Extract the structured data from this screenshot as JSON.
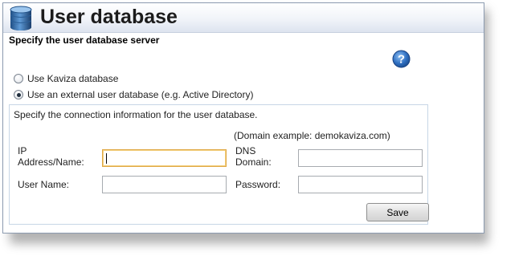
{
  "header": {
    "title": "User database",
    "icon": "database-icon"
  },
  "section": {
    "heading": "Specify the user database server",
    "help_icon": "help-question-icon"
  },
  "options": [
    {
      "label": "Use Kaviza database",
      "checked": false
    },
    {
      "label": "Use an external user database (e.g. Active Directory)",
      "checked": true
    }
  ],
  "connection": {
    "instructions": "Specify the connection information for the user database.",
    "domain_example": "(Domain example: demokaviza.com)",
    "fields": {
      "ip_address": {
        "label": "IP Address/Name:",
        "value": ""
      },
      "dns_domain": {
        "label": "DNS Domain:",
        "value": ""
      },
      "user_name": {
        "label": "User Name:",
        "value": ""
      },
      "password": {
        "label": "Password:",
        "value": ""
      }
    },
    "save_label": "Save"
  },
  "colors": {
    "title_gradient_end": "#dde4ef",
    "panel_border": "#c7d6e6",
    "focus_border": "#e0a845",
    "help_icon_blue": "#2f6fc1"
  }
}
